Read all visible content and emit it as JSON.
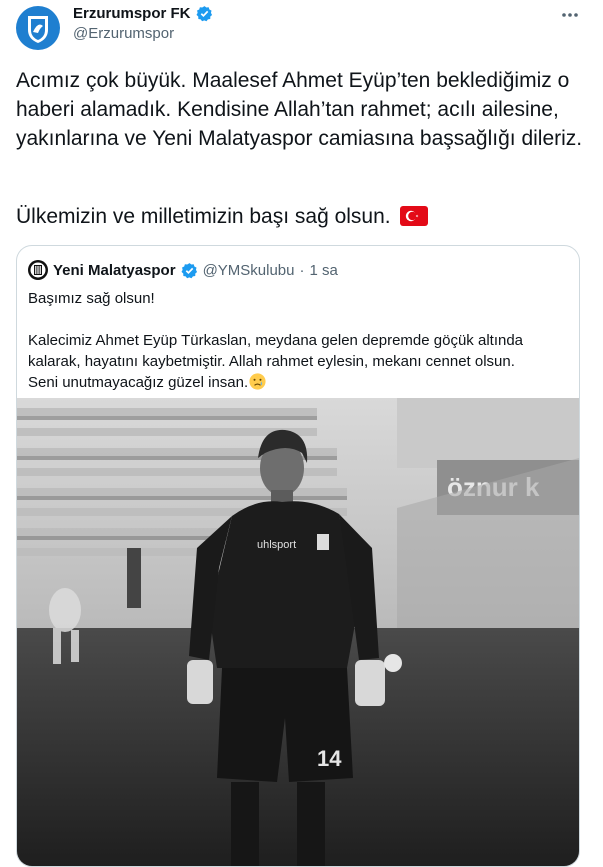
{
  "tweet": {
    "author_name": "Erzurumspor FK",
    "author_handle": "@Erzurumspor",
    "text_paragraph_1": "Acımız çok büyük. Maalesef Ahmet Eyüp’ten beklediğimiz o haberi alamadık. Kendisine Allah’tan rahmet; acılı ailesine, yakınlarına ve Yeni Malatyaspor camiasına başsağlığı dileriz.",
    "text_paragraph_2": "Ülkemizin ve milletimizin başı sağ olsun.",
    "flag_emoji": "turkey-flag-icon"
  },
  "quoted": {
    "author_name": "Yeni Malatyaspor",
    "author_handle": "@YMSkulubu",
    "separator": "·",
    "time": "1 sa",
    "line_1": "Başımız sağ olsun!",
    "line_2": "Kalecimiz Ahmet Eyüp Türkaslan, meydana gelen depremde göçük altında",
    "line_3": "kalarak, hayatını kaybetmiştir. Allah rahmet eylesin, mekanı cennet olsun.",
    "line_4": "Seni unutmayacağız güzel insan.",
    "emoji": "crying-face-icon",
    "photo": {
      "jersey_brand": "uhlsport",
      "jersey_number": "14",
      "stadium_sign": "öznur k"
    }
  },
  "colors": {
    "text": "#0f1419",
    "secondary": "#536471",
    "verified": "#1d9bf0",
    "border": "#cfd9de",
    "flag_red": "#e30a17"
  }
}
